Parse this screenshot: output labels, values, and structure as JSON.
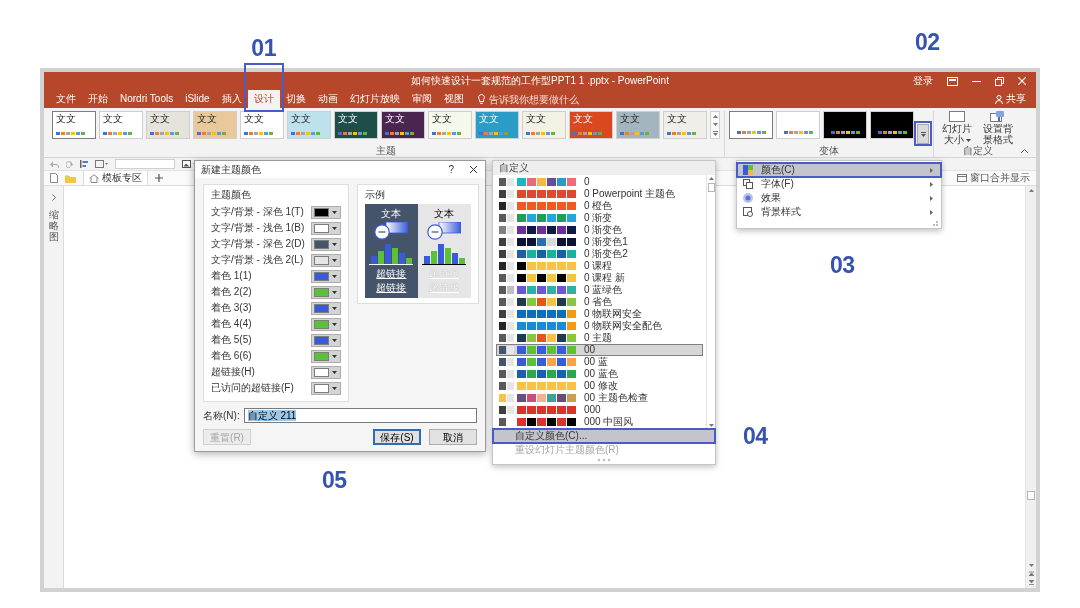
{
  "window": {
    "title": "如何快速设计一套规范的工作型PPT1 1 .pptx - PowerPoint",
    "sign_in": "登录"
  },
  "tabs": [
    {
      "label": "文件",
      "selected": false,
      "highlighted": false
    },
    {
      "label": "开始",
      "selected": false,
      "highlighted": false
    },
    {
      "label": "Nordri Tools",
      "selected": false,
      "highlighted": false
    },
    {
      "label": "iSlide",
      "selected": false,
      "highlighted": false
    },
    {
      "label": "插入",
      "selected": false,
      "highlighted": false
    },
    {
      "label": "设计",
      "selected": true,
      "highlighted": true
    },
    {
      "label": "切换",
      "selected": false,
      "highlighted": false
    },
    {
      "label": "动画",
      "selected": false,
      "highlighted": false
    },
    {
      "label": "幻灯片放映",
      "selected": false,
      "highlighted": false
    },
    {
      "label": "审阅",
      "selected": false,
      "highlighted": false
    },
    {
      "label": "视图",
      "selected": false,
      "highlighted": false
    }
  ],
  "tell_me": {
    "placeholder": "告诉我你想要做什么"
  },
  "share": {
    "label": "共享"
  },
  "ribbon": {
    "themes": {
      "label": "主题",
      "items": [
        {
          "label": "文文",
          "color": "#ffffff",
          "selected": true
        },
        {
          "label": "文文",
          "color": "#ffffff",
          "selected": false
        },
        {
          "label": "文文",
          "color": "#e6e2dc",
          "selected": false
        },
        {
          "label": "文文",
          "color": "#e9c89c",
          "selected": false
        },
        {
          "label": "文文",
          "color": "#ffffff",
          "selected": false
        },
        {
          "label": "文文",
          "color": "#bde2ec",
          "selected": false
        },
        {
          "label": "文文",
          "color": "#1f4e4a",
          "selected": false
        },
        {
          "label": "文文",
          "color": "#4a2550",
          "selected": false
        },
        {
          "label": "文文",
          "color": "#f4f9ec",
          "selected": false
        },
        {
          "label": "文文",
          "color": "#2a9cc6",
          "selected": false
        },
        {
          "label": "文文",
          "color": "#f3f1e4",
          "selected": false
        },
        {
          "label": "文文",
          "color": "#d9481f",
          "selected": false
        },
        {
          "label": "文文",
          "color": "#a3b6bf",
          "selected": false
        },
        {
          "label": "文文",
          "color": "#efeee8",
          "selected": false
        }
      ]
    },
    "variants": {
      "label": "变体",
      "items": [
        {
          "color": "#ffffff",
          "selected": true
        },
        {
          "color": "#ffffff",
          "selected": false
        },
        {
          "color": "#000000",
          "selected": false
        },
        {
          "color": "#000000",
          "selected": false
        }
      ],
      "more_button": {
        "highlighted": true
      }
    },
    "customize": {
      "label": "自定义",
      "buttons": [
        {
          "label": "幻灯片大小",
          "kind": "slide_size"
        },
        {
          "label": "设置背景格式",
          "kind": "background"
        }
      ]
    }
  },
  "doc_tabs": {
    "tabs": [
      {
        "label": "模板专区"
      }
    ],
    "merge": {
      "label": "窗口合并显示"
    }
  },
  "thumbnail_pane": {
    "label": "缩略图"
  },
  "dialog": {
    "title": "新建主题颜色",
    "help": "?",
    "colors_group": "主题颜色",
    "rows": [
      {
        "label": "文字/背景 - 深色 1(T)",
        "color": "#000000"
      },
      {
        "label": "文字/背景 - 浅色 1(B)",
        "color": "#ffffff"
      },
      {
        "label": "文字/背景 - 深色 2(D)",
        "color": "#44546a"
      },
      {
        "label": "文字/背景 - 浅色 2(L)",
        "color": "#e7e6e6"
      },
      {
        "label": "着色 1(1)",
        "color": "#3a5bd9"
      },
      {
        "label": "着色 2(2)",
        "color": "#5bc236"
      },
      {
        "label": "着色 3(3)",
        "color": "#3a5bd9"
      },
      {
        "label": "着色 4(4)",
        "color": "#5bc236"
      },
      {
        "label": "着色 5(5)",
        "color": "#3a5bd9"
      },
      {
        "label": "着色 6(6)",
        "color": "#5bc236"
      },
      {
        "label": "超链接(H)",
        "color": "#ffffff"
      },
      {
        "label": "已访问的超链接(F)",
        "color": "#ffffff"
      }
    ],
    "sample_group": "示例",
    "samples": [
      {
        "kind": "dark",
        "heading": "文本",
        "links": [
          "超链接",
          "超链接"
        ]
      },
      {
        "kind": "light",
        "heading": "文本",
        "links": [
          "超链接",
          "超链接"
        ]
      }
    ],
    "name_label": "名称(N):",
    "name_value": "自定义 211",
    "buttons": [
      {
        "label": "重置(R)",
        "disabled": true,
        "default": false
      },
      {
        "label": "保存(S)",
        "disabled": false,
        "default": true
      },
      {
        "label": "取消",
        "disabled": false,
        "default": false
      }
    ]
  },
  "color_menu": {
    "header": "自定义",
    "items": [
      {
        "label": "0",
        "selected": false,
        "swatches": [
          {
            "color": "#595959"
          },
          {
            "color": "#e7e6e6"
          },
          {
            "color": "#1cb5c4"
          },
          {
            "color": "#e76a7f"
          },
          {
            "color": "#f4b942"
          },
          {
            "color": "#6b4c9a"
          },
          {
            "color": "#2a9bc4"
          },
          {
            "color": "#ef6e75"
          }
        ]
      },
      {
        "label": "0 Powerpoint 主题色",
        "selected": false,
        "swatches": [
          {
            "color": "#404040"
          },
          {
            "color": "#e7e6e6"
          },
          {
            "color": "#e0492f"
          },
          {
            "color": "#e0492f"
          },
          {
            "color": "#e0492f"
          },
          {
            "color": "#e0492f"
          },
          {
            "color": "#e0492f"
          },
          {
            "color": "#e0492f"
          }
        ]
      },
      {
        "label": "0 橙色",
        "selected": false,
        "swatches": [
          {
            "color": "#262626"
          },
          {
            "color": "#e7e6e6"
          },
          {
            "color": "#f05a22"
          },
          {
            "color": "#f05a22"
          },
          {
            "color": "#f05a22"
          },
          {
            "color": "#f05a22"
          },
          {
            "color": "#f05a22"
          },
          {
            "color": "#f05a22"
          }
        ]
      },
      {
        "label": "0 渐变",
        "selected": false,
        "swatches": [
          {
            "color": "#595959"
          },
          {
            "color": "#e7e6e6"
          },
          {
            "color": "#1e9e5a"
          },
          {
            "color": "#20a8d8"
          },
          {
            "color": "#1e9e5a"
          },
          {
            "color": "#20a8d8"
          },
          {
            "color": "#1e9e5a"
          },
          {
            "color": "#20a8d8"
          }
        ]
      },
      {
        "label": "0 渐变色",
        "selected": false,
        "swatches": [
          {
            "color": "#808080"
          },
          {
            "color": "#e7e6e6"
          },
          {
            "color": "#6a2f9e"
          },
          {
            "color": "#0d1a4a"
          },
          {
            "color": "#6a2f9e"
          },
          {
            "color": "#0d1a4a"
          },
          {
            "color": "#6a2f9e"
          },
          {
            "color": "#0d1a4a"
          }
        ]
      },
      {
        "label": "0 渐变色1",
        "selected": false,
        "swatches": [
          {
            "color": "#404040"
          },
          {
            "color": "#e7e6e6"
          },
          {
            "color": "#0b1533"
          },
          {
            "color": "#0b1533"
          },
          {
            "color": "#2a6fb0"
          },
          {
            "color": "#d9d9d9"
          },
          {
            "color": "#0b1533"
          },
          {
            "color": "#0b1533"
          }
        ]
      },
      {
        "label": "0 渐变色2",
        "selected": false,
        "swatches": [
          {
            "color": "#404040"
          },
          {
            "color": "#e7e6e6"
          },
          {
            "color": "#1b5fa8"
          },
          {
            "color": "#1ab1a0"
          },
          {
            "color": "#1b5fa8"
          },
          {
            "color": "#1ab1a0"
          },
          {
            "color": "#1b5fa8"
          },
          {
            "color": "#1ab1a0"
          }
        ]
      },
      {
        "label": "0 课程",
        "selected": false,
        "swatches": [
          {
            "color": "#262626"
          },
          {
            "color": "#e7e6e6"
          },
          {
            "color": "#000000"
          },
          {
            "color": "#f6c343"
          },
          {
            "color": "#f6c343"
          },
          {
            "color": "#f6c343"
          },
          {
            "color": "#f6c343"
          },
          {
            "color": "#f6c343"
          }
        ]
      },
      {
        "label": "0 课程 新",
        "selected": false,
        "swatches": [
          {
            "color": "#595959"
          },
          {
            "color": "#e7e6e6"
          },
          {
            "color": "#000000"
          },
          {
            "color": "#f6c343"
          },
          {
            "color": "#000000"
          },
          {
            "color": "#f6c343"
          },
          {
            "color": "#000000"
          },
          {
            "color": "#f6c343"
          }
        ]
      },
      {
        "label": "0 蓝绿色",
        "selected": false,
        "swatches": [
          {
            "color": "#595959"
          },
          {
            "color": "#bfbfbf"
          },
          {
            "color": "#6a5acd"
          },
          {
            "color": "#2eb1a3"
          },
          {
            "color": "#6a5acd"
          },
          {
            "color": "#2eb1a3"
          },
          {
            "color": "#6a5acd"
          },
          {
            "color": "#2eb1a3"
          }
        ]
      },
      {
        "label": "0 省色",
        "selected": false,
        "swatches": [
          {
            "color": "#595959"
          },
          {
            "color": "#e7e6e6"
          },
          {
            "color": "#1f3a4d"
          },
          {
            "color": "#8cc63f"
          },
          {
            "color": "#e8541e"
          },
          {
            "color": "#f6c343"
          },
          {
            "color": "#1f3a4d"
          },
          {
            "color": "#8cc63f"
          }
        ]
      },
      {
        "label": "0 物联网安全",
        "selected": false,
        "swatches": [
          {
            "color": "#404040"
          },
          {
            "color": "#e7e6e6"
          },
          {
            "color": "#0a6fbf"
          },
          {
            "color": "#0a6fbf"
          },
          {
            "color": "#0a6fbf"
          },
          {
            "color": "#0a6fbf"
          },
          {
            "color": "#0a6fbf"
          },
          {
            "color": "#f39c12"
          }
        ]
      },
      {
        "label": "0 物联网安全配色",
        "selected": false,
        "swatches": [
          {
            "color": "#262626"
          },
          {
            "color": "#e7e6e6"
          },
          {
            "color": "#1a8ad4"
          },
          {
            "color": "#1a8ad4"
          },
          {
            "color": "#1a8ad4"
          },
          {
            "color": "#1a8ad4"
          },
          {
            "color": "#1a8ad4"
          },
          {
            "color": "#f39c12"
          }
        ]
      },
      {
        "label": "0 主题",
        "selected": false,
        "swatches": [
          {
            "color": "#595959"
          },
          {
            "color": "#e7e6e6"
          },
          {
            "color": "#1f3a4d"
          },
          {
            "color": "#8cc63f"
          },
          {
            "color": "#e8541e"
          },
          {
            "color": "#f6c343"
          },
          {
            "color": "#1f3a4d"
          },
          {
            "color": "#8cc63f"
          }
        ]
      },
      {
        "label": "00",
        "selected": true,
        "swatches": [
          {
            "color": "#44546a"
          },
          {
            "color": "#e7e6e6"
          },
          {
            "color": "#3a5bd9"
          },
          {
            "color": "#5bc236"
          },
          {
            "color": "#3a5bd9"
          },
          {
            "color": "#5bc236"
          },
          {
            "color": "#3a5bd9"
          },
          {
            "color": "#5bc236"
          }
        ]
      },
      {
        "label": "00 蓝",
        "selected": false,
        "swatches": [
          {
            "color": "#44546a"
          },
          {
            "color": "#e7e6e6"
          },
          {
            "color": "#3a5bd9"
          },
          {
            "color": "#5bc236"
          },
          {
            "color": "#3a5bd9"
          },
          {
            "color": "#f4a742"
          },
          {
            "color": "#3a5bd9"
          },
          {
            "color": "#f4a742"
          }
        ]
      },
      {
        "label": "00 蓝色",
        "selected": false,
        "swatches": [
          {
            "color": "#595959"
          },
          {
            "color": "#e7e6e6"
          },
          {
            "color": "#1a5fb4"
          },
          {
            "color": "#2ca84a"
          },
          {
            "color": "#1a5fb4"
          },
          {
            "color": "#2ca84a"
          },
          {
            "color": "#1a5fb4"
          },
          {
            "color": "#2ca84a"
          }
        ]
      },
      {
        "label": "00 修改",
        "selected": false,
        "swatches": [
          {
            "color": "#595959"
          },
          {
            "color": "#e7e6e6"
          },
          {
            "color": "#f6c343"
          },
          {
            "color": "#f6c343"
          },
          {
            "color": "#f6c343"
          },
          {
            "color": "#f6c343"
          },
          {
            "color": "#f6c343"
          },
          {
            "color": "#f6c343"
          }
        ]
      },
      {
        "label": "00 主题色检查",
        "selected": false,
        "swatches": [
          {
            "color": "#f6c343"
          },
          {
            "color": "#e7e6e6"
          },
          {
            "color": "#6b4c7a"
          },
          {
            "color": "#c94f7c"
          },
          {
            "color": "#f2b38c"
          },
          {
            "color": "#3aa39a"
          },
          {
            "color": "#6b4c7a"
          },
          {
            "color": "#c9a04f"
          }
        ]
      },
      {
        "label": "000",
        "selected": false,
        "swatches": [
          {
            "color": "#404040"
          },
          {
            "color": "#e7e6e6"
          },
          {
            "color": "#d9342b"
          },
          {
            "color": "#d9342b"
          },
          {
            "color": "#d9342b"
          },
          {
            "color": "#d9342b"
          },
          {
            "color": "#d9342b"
          },
          {
            "color": "#d9342b"
          }
        ]
      },
      {
        "label": "000 中国风",
        "selected": false,
        "swatches": [
          {
            "color": "#595959"
          },
          {
            "color": "#ffffff"
          },
          {
            "color": "#d9342b"
          },
          {
            "color": "#000000"
          },
          {
            "color": "#d9342b"
          },
          {
            "color": "#000000"
          },
          {
            "color": "#d9342b"
          },
          {
            "color": "#000000"
          }
        ]
      }
    ],
    "actions": [
      {
        "label": "自定义颜色(C)...",
        "hovered": true,
        "highlighted": true,
        "disabled": false
      },
      {
        "label": "重设幻灯片主题颜色(R)",
        "hovered": false,
        "highlighted": false,
        "disabled": true
      }
    ]
  },
  "variant_menu": {
    "items": [
      {
        "label": "颜色(C)",
        "kind": "colors",
        "hovered": true,
        "highlighted": true
      },
      {
        "label": "字体(F)",
        "kind": "fonts",
        "hovered": false,
        "highlighted": false
      },
      {
        "label": "效果",
        "kind": "effects",
        "hovered": false,
        "highlighted": false
      },
      {
        "label": "背景样式",
        "kind": "background",
        "hovered": false,
        "highlighted": false
      }
    ]
  },
  "callouts": [
    {
      "label": "01"
    },
    {
      "label": "02"
    },
    {
      "label": "03"
    },
    {
      "label": "04"
    },
    {
      "label": "05"
    }
  ]
}
